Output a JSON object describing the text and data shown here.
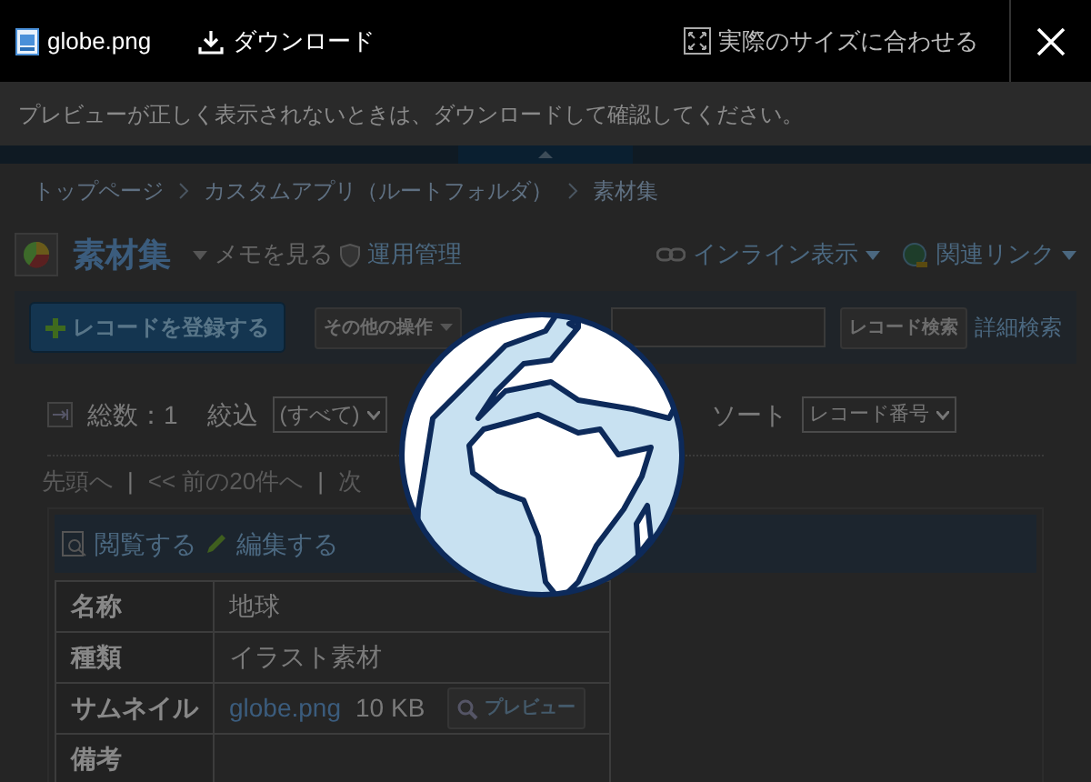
{
  "viewer_bar": {
    "file_name": "globe.png",
    "download": "ダウンロード",
    "fit_size": "実際のサイズに合わせる"
  },
  "notice": "プレビューが正しく表示されないときは、ダウンロードして確認してください。",
  "breadcrumb": [
    "トップページ",
    "カスタムアプリ（ルートフォルダ）",
    "素材集"
  ],
  "app_header": {
    "title": "素材集",
    "memo_link": "メモを見る",
    "admin_link": "運用管理",
    "inline_view": "インライン表示",
    "related_links": "関連リンク"
  },
  "toolbar": {
    "add_button": "レコードを登録する",
    "other_actions": "その他の操作",
    "search_button": "レコード検索",
    "advanced_search": "詳細検索"
  },
  "list_header": {
    "total": "総数：1",
    "filter_label": "絞込",
    "filter_value": "(すべて)",
    "sort_label": "ソート",
    "sort_value": "レコード番号"
  },
  "pager": [
    {
      "kind": "link",
      "label": "先頭へ"
    },
    {
      "kind": "separator",
      "label": "|"
    },
    {
      "kind": "link",
      "label": "<< 前の20件へ"
    },
    {
      "kind": "separator",
      "label": "|"
    },
    {
      "kind": "link",
      "label": "次"
    }
  ],
  "record_actions": [
    {
      "kind": "view",
      "label": "閲覧する"
    },
    {
      "kind": "edit",
      "label": "編集する"
    }
  ],
  "record_fields": [
    {
      "kind": "text",
      "label": "名称",
      "value": "地球"
    },
    {
      "kind": "text",
      "label": "種類",
      "value": "イラスト素材"
    },
    {
      "kind": "file",
      "label": "サムネイル",
      "file": "globe.png",
      "size": "10 KB",
      "preview_button": "プレビュー"
    },
    {
      "kind": "text",
      "label": "備考"
    }
  ]
}
